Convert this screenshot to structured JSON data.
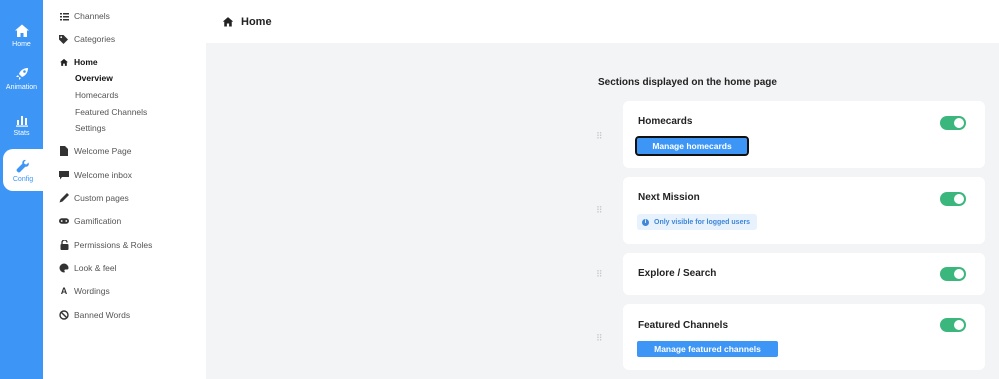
{
  "rail": {
    "items": [
      {
        "label": "Home",
        "icon": "home-icon"
      },
      {
        "label": "Animation",
        "icon": "rocket-icon"
      },
      {
        "label": "Stats",
        "icon": "bar-chart-icon"
      },
      {
        "label": "Config",
        "icon": "wrench-icon"
      }
    ],
    "active": "Config"
  },
  "nav": {
    "items": [
      {
        "label": "Channels",
        "icon": "list-icon"
      },
      {
        "label": "Categories",
        "icon": "tag-icon"
      },
      {
        "label": "Home",
        "icon": "home-icon"
      },
      {
        "label": "Welcome Page",
        "icon": "file-icon"
      },
      {
        "label": "Welcome inbox",
        "icon": "chat-icon"
      },
      {
        "label": "Custom pages",
        "icon": "pen-icon"
      },
      {
        "label": "Gamification",
        "icon": "gamepad-icon"
      },
      {
        "label": "Permissions & Roles",
        "icon": "lock-icon"
      },
      {
        "label": "Look & feel",
        "icon": "palette-icon"
      },
      {
        "label": "Wordings",
        "icon": "font-icon"
      },
      {
        "label": "Banned Words",
        "icon": "ban-icon"
      }
    ],
    "home_sub": [
      {
        "label": "Overview"
      },
      {
        "label": "Homecards"
      },
      {
        "label": "Featured Channels"
      },
      {
        "label": "Settings"
      }
    ]
  },
  "header": {
    "title": "Home",
    "icon": "home-icon"
  },
  "main": {
    "section_title": "Sections displayed on the home page",
    "cards": [
      {
        "name": "Homecards",
        "enabled": true,
        "button": "Manage homecards"
      },
      {
        "name": "Next Mission",
        "enabled": true,
        "badge": "Only visible for logged users"
      },
      {
        "name": "Explore / Search",
        "enabled": true
      },
      {
        "name": "Featured Channels",
        "enabled": true,
        "button": "Manage featured channels"
      }
    ]
  },
  "colors": {
    "accent": "#3d96f5",
    "toggle_on": "#3bb77e"
  }
}
